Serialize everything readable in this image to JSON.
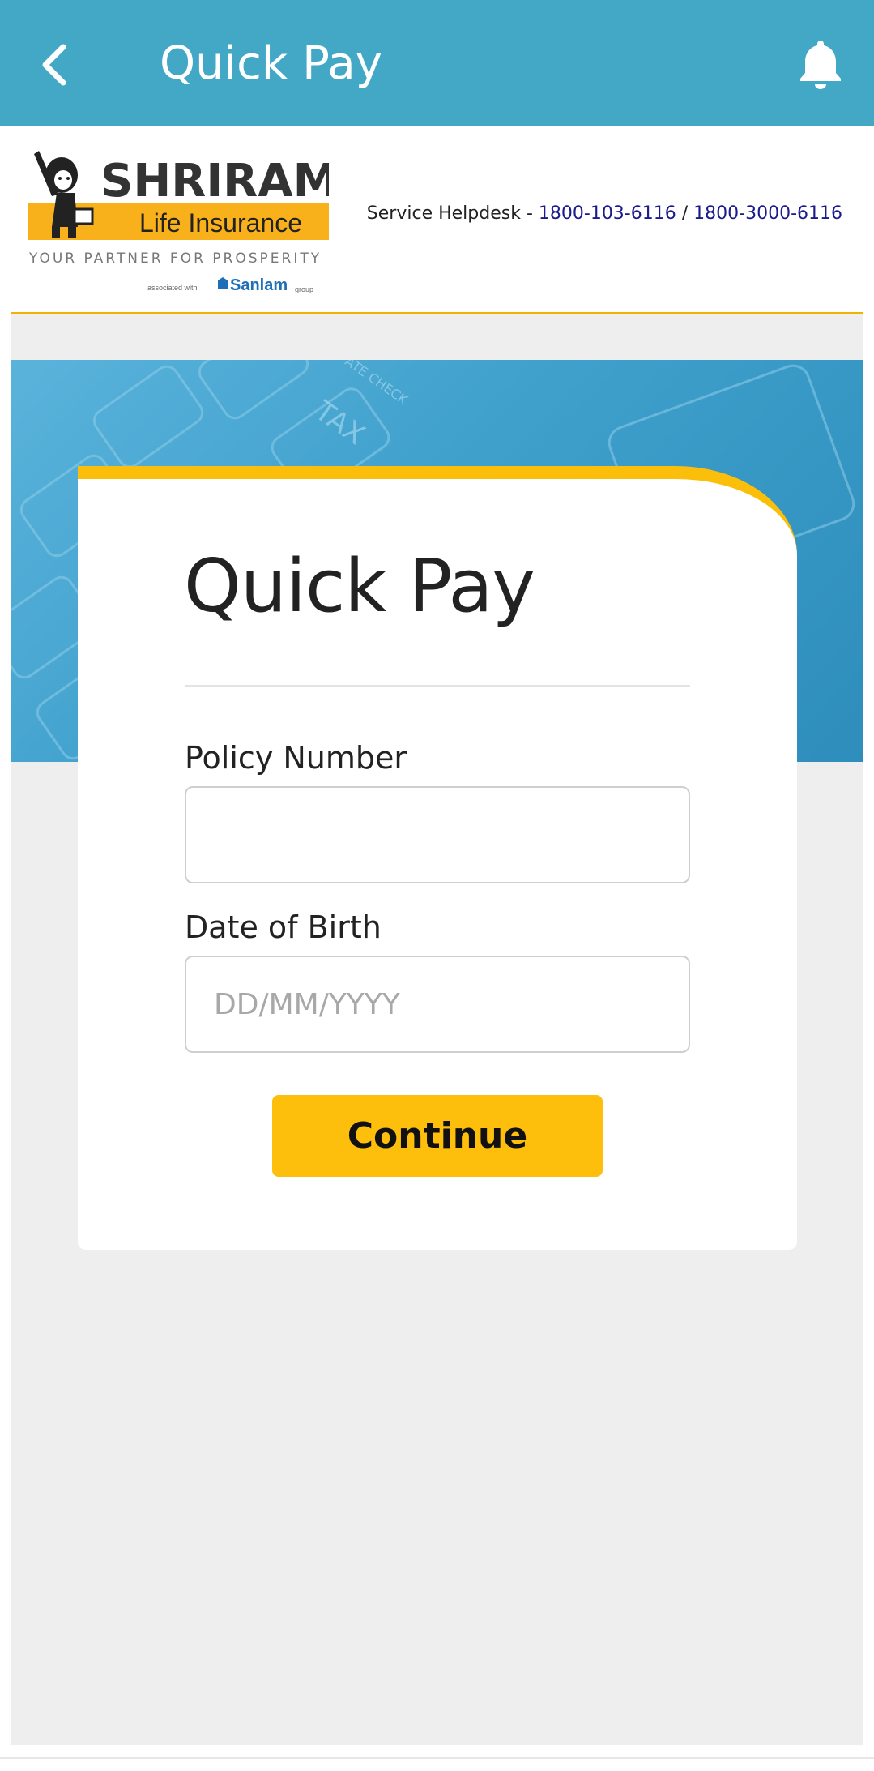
{
  "appbar": {
    "title": "Quick Pay",
    "back_icon": "chevron-left-icon",
    "notification_icon": "bell-icon",
    "background_color": "#42a8c6"
  },
  "brand": {
    "logo_name": "SHRIRAM",
    "logo_sub": "Life Insurance",
    "logo_tagline": "YOUR PARTNER FOR PROSPERITY",
    "logo_associated": "associated with",
    "logo_partner": "Sanlam",
    "logo_group": "group",
    "helpdesk_label": "Service Helpdesk - ",
    "phone_1": "1800-103-6116",
    "separator": " / ",
    "phone_2": "1800-3000-6116",
    "accent_color": "#fbbf0b"
  },
  "banner": {
    "tax_text": "TAX",
    "check_text": "ATE CHECK"
  },
  "form": {
    "title": "Quick Pay",
    "policy_label": "Policy Number",
    "policy_value": "",
    "policy_placeholder": "",
    "dob_label": "Date of Birth",
    "dob_value": "",
    "dob_placeholder": "DD/MM/YYYY",
    "continue_label": "Continue",
    "button_color": "#fdbf0b"
  }
}
